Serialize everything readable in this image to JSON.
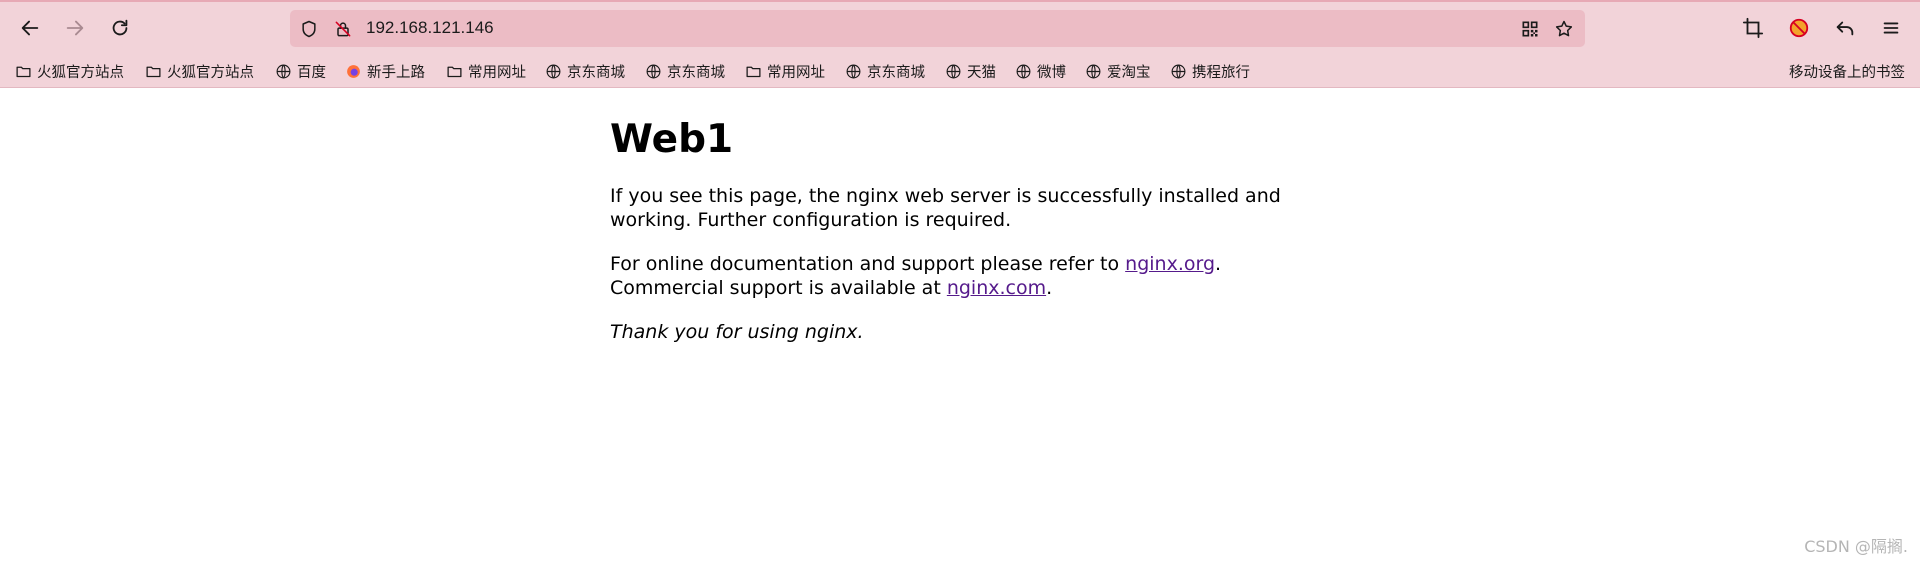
{
  "browser": {
    "url": "192.168.121.146",
    "bookmarks": [
      {
        "label": "火狐官方站点",
        "icon": "folder-icon"
      },
      {
        "label": "火狐官方站点",
        "icon": "folder-icon"
      },
      {
        "label": "百度",
        "icon": "globe-icon"
      },
      {
        "label": "新手上路",
        "icon": "firefox-icon"
      },
      {
        "label": "常用网址",
        "icon": "folder-icon"
      },
      {
        "label": "京东商城",
        "icon": "globe-icon"
      },
      {
        "label": "京东商城",
        "icon": "globe-icon"
      },
      {
        "label": "常用网址",
        "icon": "folder-icon"
      },
      {
        "label": "京东商城",
        "icon": "globe-icon"
      },
      {
        "label": "天猫",
        "icon": "globe-icon"
      },
      {
        "label": "微博",
        "icon": "globe-icon"
      },
      {
        "label": "爱淘宝",
        "icon": "globe-icon"
      },
      {
        "label": "携程旅行",
        "icon": "globe-icon"
      }
    ],
    "mobile_bookmarks": "移动设备上的书签",
    "colors": {
      "toolbar": "#f2d3d9",
      "urlbar": "#ecbcc5",
      "link": "#551a8b"
    }
  },
  "page": {
    "title": "Web1",
    "para1": "If you see this page, the nginx web server is successfully installed and working. Further configuration is required.",
    "para2_prefix": "For online documentation and support please refer to ",
    "link1": "nginx.org",
    "para2_mid": ".",
    "para2_line2": "Commercial support is available at ",
    "link2": "nginx.com",
    "para2_end": ".",
    "thanks": "Thank you for using nginx."
  },
  "watermark": "CSDN @隔搁."
}
